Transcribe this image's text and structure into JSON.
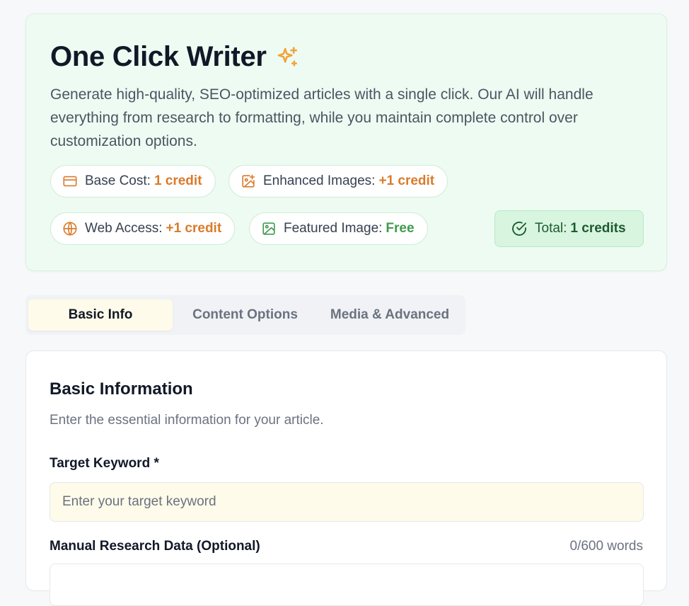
{
  "hero": {
    "title": "One Click Writer",
    "description": "Generate high-quality, SEO-optimized articles with a single click. Our AI will handle everything from research to formatting, while you maintain complete control over customization options.",
    "pills": [
      {
        "label": "Base Cost:",
        "value": "1 credit",
        "icon": "credit-card-icon"
      },
      {
        "label": "Enhanced Images:",
        "value": "+1 credit",
        "icon": "image-plus-icon"
      },
      {
        "label": "Web Access:",
        "value": "+1 credit",
        "icon": "globe-icon"
      },
      {
        "label": "Featured Image:",
        "value": "Free",
        "icon": "image-icon"
      }
    ],
    "total": {
      "label": "Total:",
      "value": "1 credits",
      "icon": "check-circle-icon"
    }
  },
  "tabs": [
    {
      "label": "Basic Info",
      "active": true
    },
    {
      "label": "Content Options",
      "active": false
    },
    {
      "label": "Media & Advanced",
      "active": false
    }
  ],
  "card": {
    "title": "Basic Information",
    "subtitle": "Enter the essential information for your article.",
    "keyword_label": "Target Keyword *",
    "keyword_placeholder": "Enter your target keyword",
    "research_label": "Manual Research Data (Optional)",
    "word_count": "0/600 words"
  },
  "colors": {
    "accent_orange": "#d97b2b",
    "accent_green": "#3f9b4f",
    "hero_bg": "#eefbf2",
    "sparkle": "#f2a33a"
  }
}
